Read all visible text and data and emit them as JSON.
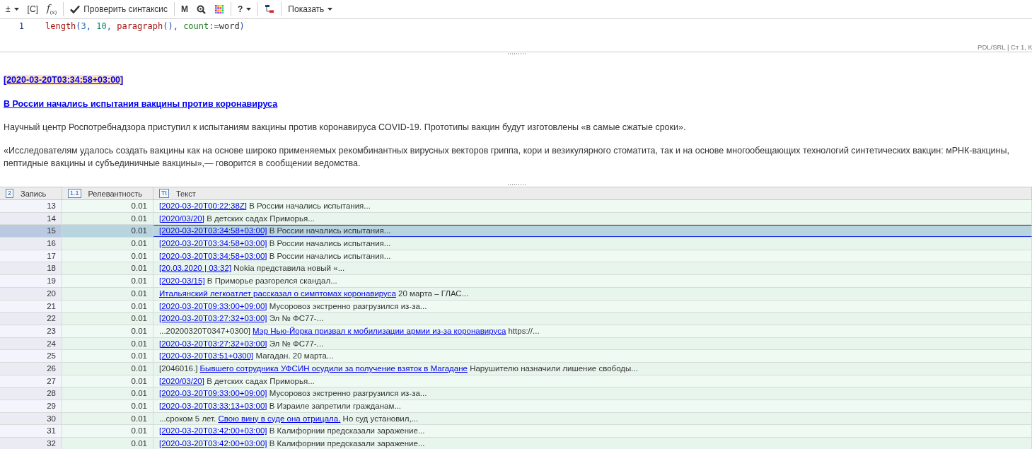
{
  "toolbar": [
    {
      "kind": "text",
      "label": "±",
      "caret": true
    },
    {
      "kind": "text",
      "label": "[C]",
      "caret": false
    },
    {
      "kind": "function",
      "label": "f",
      "sub": "(x)",
      "caret": false
    },
    {
      "kind": "sep"
    },
    {
      "kind": "check",
      "label": "Проверить синтаксис",
      "caret": false
    },
    {
      "kind": "sep"
    },
    {
      "kind": "bold",
      "label": "M",
      "caret": false
    },
    {
      "kind": "zoom",
      "caret": false
    },
    {
      "kind": "palette",
      "caret": false
    },
    {
      "kind": "sep"
    },
    {
      "kind": "bold",
      "label": "?",
      "caret": true
    },
    {
      "kind": "sep"
    },
    {
      "kind": "tree",
      "caret": false
    },
    {
      "kind": "sep"
    },
    {
      "kind": "text",
      "label": "Показать",
      "caret": true
    }
  ],
  "editor": {
    "line_number": "1",
    "tokens": [
      {
        "text": "length",
        "kind": "func"
      },
      {
        "text": "(",
        "kind": "punct"
      },
      {
        "text": "3",
        "kind": "num"
      },
      {
        "text": ", ",
        "kind": "punct"
      },
      {
        "text": "10",
        "kind": "num2"
      },
      {
        "text": ", ",
        "kind": "punct"
      },
      {
        "text": "paragraph",
        "kind": "func"
      },
      {
        "text": "()",
        "kind": "punct"
      },
      {
        "text": ", ",
        "kind": "punct"
      },
      {
        "text": "count",
        "kind": "param"
      },
      {
        "text": ":=",
        "kind": "punct"
      },
      {
        "text": "word",
        "kind": "plain"
      },
      {
        "text": ")",
        "kind": "punct"
      }
    ],
    "status": "PDL/SRL | Ст 1, К"
  },
  "preview": {
    "timestamp": "[2020-03-20T03:34:58+03:00]",
    "title": "В России начались испытания вакцины против коронавируса",
    "paragraphs": [
      "Научный центр Роспотребнадзора приступил к испытаниям вакцины против коронавируса COVID-19. Прототипы вакцин будут изготовлены «в самые сжатые сроки».",
      "«Исследователям удалось создать вакцины как на основе широко применяемых рекомбинантных вирусных векторов гриппа, кори и везикулярного стоматита, так и на основе многообещающих технологий синтетических вакцин: мРНК-вакцины, пептидные вакцины и субъединичные вакцины»,— говорится в сообщении ведомства."
    ]
  },
  "table": {
    "columns": [
      {
        "icon": "2",
        "label": "Запись"
      },
      {
        "icon": "1.1",
        "label": "Релевантность"
      },
      {
        "icon": "Tt",
        "label": "Текст"
      }
    ],
    "rows": [
      {
        "record": "13",
        "relevance": "0.01",
        "selected": false,
        "text": [
          {
            "t": "[2020-03-20T00:22:38Z]",
            "link": true
          },
          {
            "t": " В России начались испытания...",
            "link": false
          }
        ]
      },
      {
        "record": "14",
        "relevance": "0.01",
        "selected": false,
        "text": [
          {
            "t": "[2020/03/20]",
            "link": true
          },
          {
            "t": " В детских садах Приморья...",
            "link": false
          }
        ]
      },
      {
        "record": "15",
        "relevance": "0.01",
        "selected": true,
        "text": [
          {
            "t": "[2020-03-20T03:34:58+03:00]",
            "link": true
          },
          {
            "t": " В России начались испытания...",
            "link": false
          }
        ]
      },
      {
        "record": "16",
        "relevance": "0.01",
        "selected": false,
        "text": [
          {
            "t": "[2020-03-20T03:34:58+03:00]",
            "link": true
          },
          {
            "t": " В России начались испытания...",
            "link": false
          }
        ]
      },
      {
        "record": "17",
        "relevance": "0.01",
        "selected": false,
        "text": [
          {
            "t": "[2020-03-20T03:34:58+03:00]",
            "link": true
          },
          {
            "t": " В России начались испытания...",
            "link": false
          }
        ]
      },
      {
        "record": "18",
        "relevance": "0.01",
        "selected": false,
        "text": [
          {
            "t": "[20.03.2020 | 03:32]",
            "link": true
          },
          {
            "t": " Nokia представила новый «...",
            "link": false
          }
        ]
      },
      {
        "record": "19",
        "relevance": "0.01",
        "selected": false,
        "text": [
          {
            "t": "[2020-03/15]",
            "link": true
          },
          {
            "t": " В Приморье разгорелся скандал...",
            "link": false
          }
        ]
      },
      {
        "record": "20",
        "relevance": "0.01",
        "selected": false,
        "text": [
          {
            "t": "Итальянский легкоатлет рассказал о симптомах коронавируса",
            "link": true
          },
          {
            "t": " 20 марта – ГЛАС...",
            "link": false
          }
        ]
      },
      {
        "record": "21",
        "relevance": "0.01",
        "selected": false,
        "text": [
          {
            "t": "[2020-03-20T09:33:00+09:00]",
            "link": true
          },
          {
            "t": " Мусоровоз экстренно разгрузился из-за...",
            "link": false
          }
        ]
      },
      {
        "record": "22",
        "relevance": "0.01",
        "selected": false,
        "text": [
          {
            "t": "[2020-03-20T03:27:32+03:00]",
            "link": true
          },
          {
            "t": " Эл № ФС77-...",
            "link": false
          }
        ]
      },
      {
        "record": "23",
        "relevance": "0.01",
        "selected": false,
        "text": [
          {
            "t": "...20200320T0347+0300] ",
            "link": false
          },
          {
            "t": "Мэр Нью-Йорка призвал к мобилизации армии из-за коронавируса",
            "link": true
          },
          {
            "t": " https://...",
            "link": false
          }
        ]
      },
      {
        "record": "24",
        "relevance": "0.01",
        "selected": false,
        "text": [
          {
            "t": "[2020-03-20T03:27:32+03:00]",
            "link": true
          },
          {
            "t": " Эл № ФС77-...",
            "link": false
          }
        ]
      },
      {
        "record": "25",
        "relevance": "0.01",
        "selected": false,
        "text": [
          {
            "t": "[2020-03-20T03:51+0300]",
            "link": true
          },
          {
            "t": " Магадан. 20 марта...",
            "link": false
          }
        ]
      },
      {
        "record": "26",
        "relevance": "0.01",
        "selected": false,
        "text": [
          {
            "t": "[2046016.] ",
            "link": false
          },
          {
            "t": "Бывшего сотрудника УФСИН осудили за получение взяток в Магадане",
            "link": true
          },
          {
            "t": " Нарушителю назначили лишение свободы...",
            "link": false
          }
        ]
      },
      {
        "record": "27",
        "relevance": "0.01",
        "selected": false,
        "text": [
          {
            "t": "[2020/03/20]",
            "link": true
          },
          {
            "t": " В детских садах Приморья...",
            "link": false
          }
        ]
      },
      {
        "record": "28",
        "relevance": "0.01",
        "selected": false,
        "text": [
          {
            "t": "[2020-03-20T09:33:00+09:00]",
            "link": true
          },
          {
            "t": " Мусоровоз экстренно разгрузился из-за...",
            "link": false
          }
        ]
      },
      {
        "record": "29",
        "relevance": "0.01",
        "selected": false,
        "text": [
          {
            "t": "[2020-03-20T03:33:13+03:00]",
            "link": true
          },
          {
            "t": " В Израиле запретили гражданам...",
            "link": false
          }
        ]
      },
      {
        "record": "30",
        "relevance": "0.01",
        "selected": false,
        "text": [
          {
            "t": "...сроком 5 лет. ",
            "link": false
          },
          {
            "t": "Свою вину в суде она отрицала.",
            "link": true
          },
          {
            "t": " Но суд установил,...",
            "link": false
          }
        ]
      },
      {
        "record": "31",
        "relevance": "0.01",
        "selected": false,
        "text": [
          {
            "t": "[2020-03-20T03:42:00+03:00]",
            "link": true
          },
          {
            "t": " В Калифорнии предсказали заражение...",
            "link": false
          }
        ]
      },
      {
        "record": "32",
        "relevance": "0.01",
        "selected": false,
        "text": [
          {
            "t": "[2020-03-20T03:42:00+03:00]",
            "link": true
          },
          {
            "t": " В Калифорнии предсказали заражение...",
            "link": false
          }
        ]
      }
    ]
  }
}
